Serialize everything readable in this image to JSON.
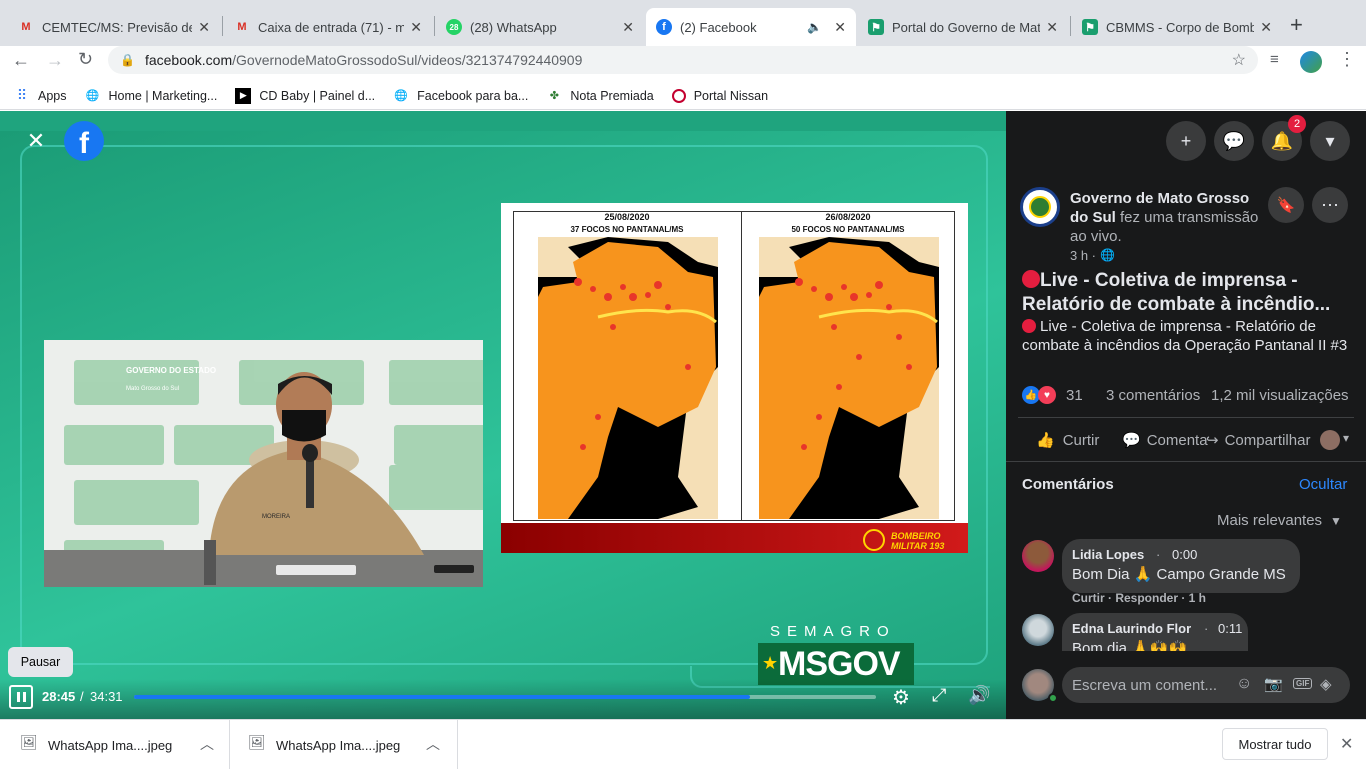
{
  "tabs": [
    {
      "title": "CEMTEC/MS: Previsão de",
      "favicon": "gmail-icon"
    },
    {
      "title": "Caixa de entrada (71) - m",
      "favicon": "gmail-icon"
    },
    {
      "title": "(28) WhatsApp",
      "favicon": "whatsapp-icon",
      "badge": "28"
    },
    {
      "title": "(2) Facebook",
      "favicon": "facebook-icon"
    },
    {
      "title": "Portal do Governo de Mat",
      "favicon": "government-icon"
    },
    {
      "title": "CBMMS - Corpo de Bomb",
      "favicon": "government-icon"
    }
  ],
  "address": {
    "host": "facebook.com",
    "path": "/GovernodeMatoGrossodoSul/videos/321374792440909"
  },
  "bookmarks": [
    "Apps",
    "Home | Marketing...",
    "CD Baby | Painel d...",
    "Facebook para ba...",
    "Nota Premiada",
    "Portal Nissan"
  ],
  "video": {
    "tooltip": "Pausar",
    "time_current": "28:45",
    "time_total": "34:31",
    "progress": 0.83,
    "map_left": {
      "date": "25/08/2020",
      "caption": "37 FOCOS NO PANTANAL/MS"
    },
    "map_right": {
      "date": "26/08/2020",
      "caption": "50 FOCOS NO PANTANAL/MS"
    },
    "banner_text": "BOMBEIRO MILITAR 193",
    "semagro": "SEMAGRO",
    "msgov": "MSGOV",
    "backdrop_text": "GOVERNO DO ESTADO",
    "backdrop_sub": "Mato Grosso do Sul",
    "nametag": "MOREIRA"
  },
  "panel": {
    "notif_count": "2",
    "page_name": "Governo de Mato Grosso do Sul",
    "action": "fez uma transmissão ao vivo.",
    "time": "3 h ·",
    "title": "Live - Coletiva de imprensa - Relatório de combate à incêndio...",
    "description": "Live - Coletiva de imprensa - Relatório de combate à incêndios da Operação Pantanal II #3",
    "reactions": "31",
    "comments_count": "3 comentários",
    "views": "1,2 mil visualizações",
    "like": "Curtir",
    "comment": "Comentar",
    "share": "Compartilhar",
    "comments_heading": "Comentários",
    "hide": "Ocultar",
    "sort": "Mais relevantes",
    "comments": [
      {
        "author": "Lidia Lopes",
        "time": "0:00",
        "text": "Bom Dia 🙏 Campo Grande MS",
        "actions": "Curtir · Responder · 1 h"
      },
      {
        "author": "Edna Laurindo Flor",
        "time": "0:11",
        "text": "Bom dia 🙏🙌🙌"
      }
    ],
    "write_placeholder": "Escreva um coment..."
  },
  "downloads": {
    "items": [
      "WhatsApp Ima....jpeg",
      "WhatsApp Ima....jpeg"
    ],
    "show_all": "Mostrar tudo"
  },
  "colors": {
    "facebook": "#1877f2",
    "panel_bg": "#18191a",
    "video_bg": "#1fa47e",
    "fire": "#f7941d",
    "hotspot": "#e8352a",
    "danger": "#e41e3f"
  }
}
